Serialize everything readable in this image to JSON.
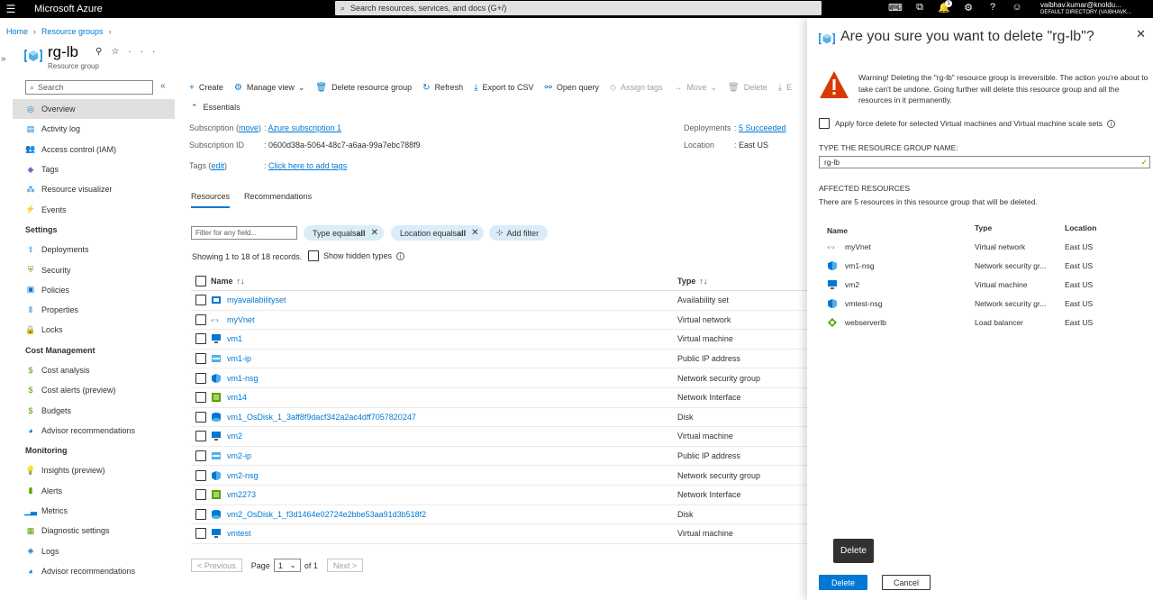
{
  "topbar": {
    "app_title": "Microsoft Azure",
    "search_placeholder": "Search resources, services, and docs (G+/)",
    "notification_count": "1",
    "user_name": "vaibhav.kumar@knoldu...",
    "user_directory": "DEFAULT DIRECTORY (VAIBHAVK..."
  },
  "breadcrumb": {
    "home": "Home",
    "resource_groups": "Resource groups"
  },
  "resource": {
    "name": "rg-lb",
    "type": "Resource group"
  },
  "sidebar": {
    "search_placeholder": "Search",
    "items_top": [
      {
        "label": "Overview",
        "icon": "overview-icon"
      },
      {
        "label": "Activity log",
        "icon": "activity-log-icon"
      },
      {
        "label": "Access control (IAM)",
        "icon": "iam-icon"
      },
      {
        "label": "Tags",
        "icon": "tag-icon"
      },
      {
        "label": "Resource visualizer",
        "icon": "visualizer-icon"
      },
      {
        "label": "Events",
        "icon": "lightning-icon"
      }
    ],
    "settings_label": "Settings",
    "settings_items": [
      {
        "label": "Deployments"
      },
      {
        "label": "Security"
      },
      {
        "label": "Policies"
      },
      {
        "label": "Properties"
      },
      {
        "label": "Locks"
      }
    ],
    "cost_label": "Cost Management",
    "cost_items": [
      {
        "label": "Cost analysis"
      },
      {
        "label": "Cost alerts (preview)"
      },
      {
        "label": "Budgets"
      },
      {
        "label": "Advisor recommendations"
      }
    ],
    "monitoring_label": "Monitoring",
    "monitoring_items": [
      {
        "label": "Insights (preview)"
      },
      {
        "label": "Alerts"
      },
      {
        "label": "Metrics"
      },
      {
        "label": "Diagnostic settings"
      },
      {
        "label": "Logs"
      },
      {
        "label": "Advisor recommendations"
      }
    ]
  },
  "toolbar": {
    "create": "Create",
    "manage_view": "Manage view",
    "delete_rg": "Delete resource group",
    "refresh": "Refresh",
    "export_csv": "Export to CSV",
    "open_query": "Open query",
    "assign_tags": "Assign tags",
    "move": "Move",
    "delete": "Delete",
    "export_template": "E"
  },
  "essentials": {
    "heading": "Essentials",
    "subscription_label": "Subscription",
    "subscription_move": "move",
    "subscription_value": "Azure subscription 1",
    "subscription_id_label": "Subscription ID",
    "subscription_id_value": "0600d38a-5064-48c7-a6aa-99a7ebc788f9",
    "tags_label": "Tags",
    "tags_edit": "edit",
    "tags_value": "Click here to add tags",
    "deployments_label": "Deployments",
    "deployments_value": "5 Succeeded",
    "location_label": "Location",
    "location_value": "East US"
  },
  "tabs": [
    "Resources",
    "Recommendations"
  ],
  "filters": {
    "placeholder": "Filter for any field...",
    "pill_type_prefix": "Type equals ",
    "pill_type_value": "all",
    "pill_location_prefix": "Location equals ",
    "pill_location_value": "all",
    "add_filter": "Add filter",
    "showing": "Showing 1 to 18 of 18 records.",
    "show_hidden": "Show hidden types"
  },
  "table": {
    "col_name": "Name",
    "col_type": "Type",
    "rows": [
      {
        "name": "myavailabilityset",
        "type": "Availability set",
        "icon": "availability-set-icon"
      },
      {
        "name": "myVnet",
        "type": "Virtual network",
        "icon": "vnet-icon"
      },
      {
        "name": "vm1",
        "type": "Virtual machine",
        "icon": "vm-icon"
      },
      {
        "name": "vm1-ip",
        "type": "Public IP address",
        "icon": "public-ip-icon"
      },
      {
        "name": "vm1-nsg",
        "type": "Network security group",
        "icon": "nsg-icon"
      },
      {
        "name": "vm14",
        "type": "Network Interface",
        "icon": "nic-icon"
      },
      {
        "name": "vm1_OsDisk_1_3aff8f9dacf342a2ac4dff7057820247",
        "type": "Disk",
        "icon": "disk-icon"
      },
      {
        "name": "vm2",
        "type": "Virtual machine",
        "icon": "vm-icon"
      },
      {
        "name": "vm2-ip",
        "type": "Public IP address",
        "icon": "public-ip-icon"
      },
      {
        "name": "vm2-nsg",
        "type": "Network security group",
        "icon": "nsg-icon"
      },
      {
        "name": "vm2273",
        "type": "Network Interface",
        "icon": "nic-icon"
      },
      {
        "name": "vm2_OsDisk_1_f3d1464e02724e2bbe53aa91d3b518f2",
        "type": "Disk",
        "icon": "disk-icon"
      },
      {
        "name": "vmtest",
        "type": "Virtual machine",
        "icon": "vm-icon"
      }
    ]
  },
  "pager": {
    "previous": "< Previous",
    "page": "Page",
    "page_value": "1",
    "of": "of 1",
    "next": "Next >"
  },
  "panel": {
    "title": "Are you sure you want to delete \"rg-lb\"?",
    "warning": "Warning! Deleting the \"rg-lb\" resource group is irreversible. The action you're about to take can't be undone. Going further will delete this resource group and all the resources in it permanently.",
    "force_delete": "Apply force delete for selected Virtual machines and Virtual machine scale sets",
    "type_label": "TYPE THE RESOURCE GROUP NAME:",
    "type_value": "rg-lb",
    "affected_heading": "AFFECTED RESOURCES",
    "affected_sub": "There are 5 resources in this resource group that will be deleted.",
    "col_name": "Name",
    "col_type": "Type",
    "col_location": "Location",
    "resources": [
      {
        "name": "myVnet",
        "type": "Virtual network",
        "location": "East US"
      },
      {
        "name": "vm1-nsg",
        "type": "Network security gr...",
        "location": "East US"
      },
      {
        "name": "vm2",
        "type": "Virtual machine",
        "location": "East US"
      },
      {
        "name": "vmtest-nsg",
        "type": "Network security gr...",
        "location": "East US"
      },
      {
        "name": "webserverlb",
        "type": "Load balancer",
        "location": "East US"
      }
    ],
    "tooltip": "Delete",
    "delete_button": "Delete",
    "cancel_button": "Cancel"
  },
  "colors": {
    "accent": "#0078d4",
    "warning": "#d83b01",
    "topbar": "#000000"
  }
}
